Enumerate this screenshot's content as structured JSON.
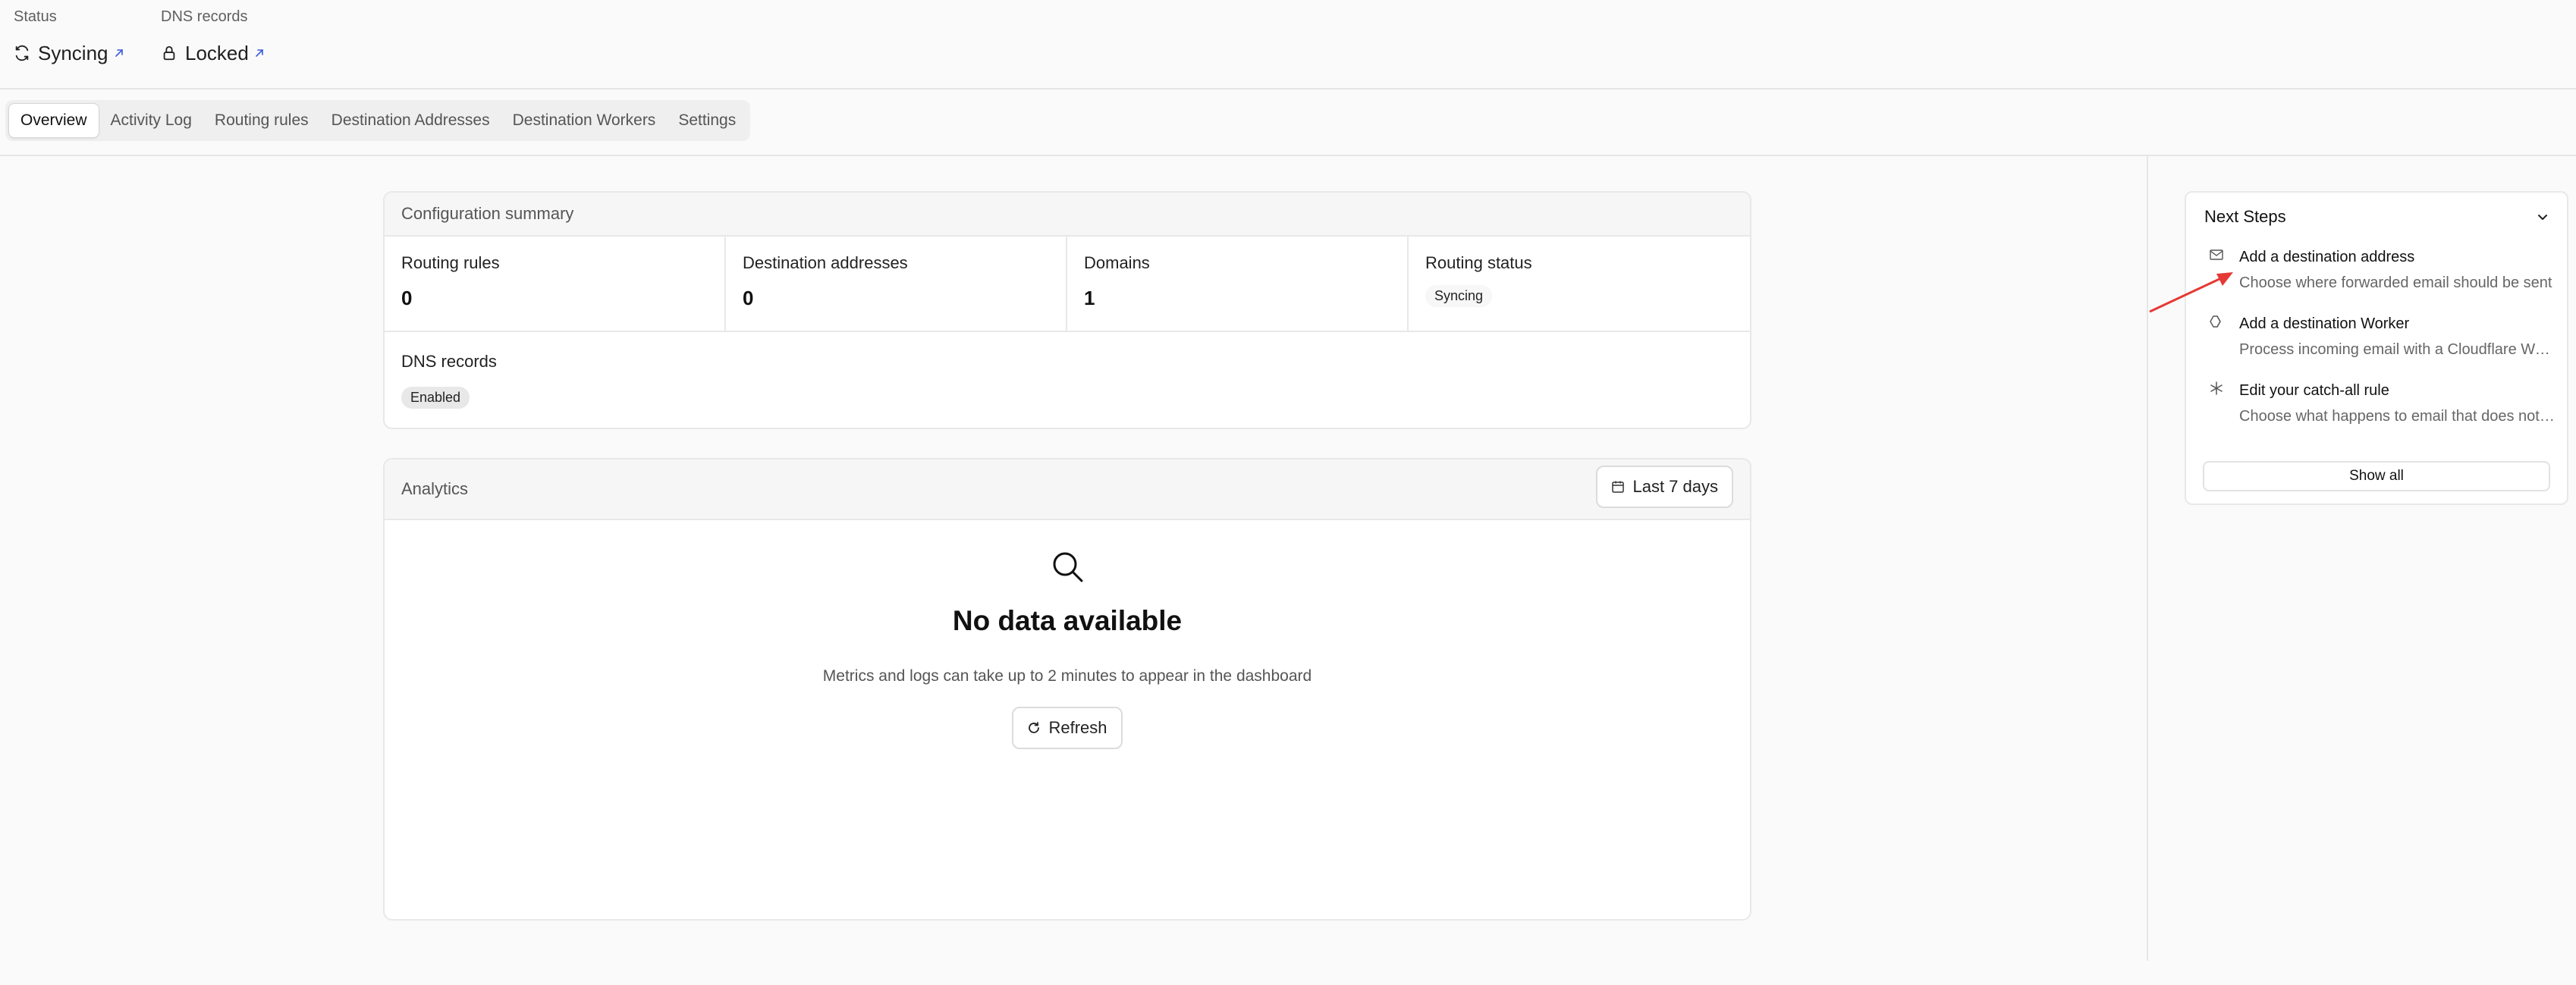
{
  "header": {
    "status_label": "Status",
    "status_value": "Syncing",
    "dns_label": "DNS records",
    "dns_value": "Locked"
  },
  "tabs": [
    {
      "label": "Overview",
      "active": true
    },
    {
      "label": "Activity Log"
    },
    {
      "label": "Routing rules"
    },
    {
      "label": "Destination Addresses"
    },
    {
      "label": "Destination Workers"
    },
    {
      "label": "Settings"
    }
  ],
  "summary": {
    "title": "Configuration summary",
    "routing_rules_label": "Routing rules",
    "routing_rules_value": "0",
    "destination_addresses_label": "Destination addresses",
    "destination_addresses_value": "0",
    "domains_label": "Domains",
    "domains_value": "1",
    "routing_status_label": "Routing status",
    "routing_status_value": "Syncing",
    "dns_records_label": "DNS records",
    "dns_records_value": "Enabled"
  },
  "analytics": {
    "title": "Analytics",
    "range_label": "Last 7 days",
    "empty_title": "No data available",
    "empty_sub": "Metrics and logs can take up to 2 minutes to appear in the dashboard",
    "refresh_label": "Refresh"
  },
  "next_steps": {
    "title": "Next Steps",
    "items": [
      {
        "icon": "envelope-icon",
        "title": "Add a destination address",
        "desc": "Choose where forwarded email should be sent"
      },
      {
        "icon": "worker-icon",
        "title": "Add a destination Worker",
        "desc": "Process incoming email with a Cloudflare Worker"
      },
      {
        "icon": "asterisk-icon",
        "title": "Edit your catch-all rule",
        "desc": "Choose what happens to email that does not match a rule"
      }
    ],
    "show_all_label": "Show all"
  },
  "colors": {
    "annotation_arrow": "#e53935",
    "link_arrow": "#3b5bdb"
  }
}
